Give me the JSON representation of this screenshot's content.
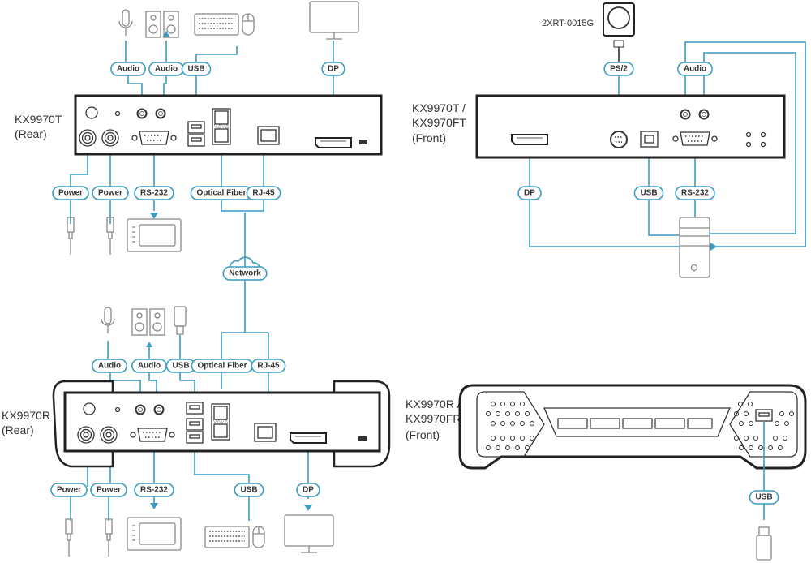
{
  "colors": {
    "connector_line": "#3a9cc0",
    "device_outline": "#222222",
    "peripheral": "#888888"
  },
  "top_left": {
    "title_line1": "KX9970T",
    "title_line2": "(Rear)",
    "labels": {
      "audio_in": "Audio",
      "audio_out": "Audio",
      "usb": "USB",
      "dp": "DP",
      "power1": "Power",
      "power2": "Power",
      "rs232": "RS-232",
      "optical": "Optical Fiber",
      "rj45": "RJ-45"
    }
  },
  "network": {
    "label": "Network"
  },
  "bottom_left": {
    "title_line1": "KX9970R",
    "title_line2": "(Rear)",
    "labels": {
      "audio_in": "Audio",
      "audio_out": "Audio",
      "usb_top": "USB",
      "optical": "Optical Fiber",
      "rj45": "RJ-45",
      "power1": "Power",
      "power2": "Power",
      "rs232": "RS-232",
      "usb_bottom": "USB",
      "dp": "DP"
    }
  },
  "top_right": {
    "title_line1": "KX9970T /",
    "title_line2": "KX9970FT",
    "title_line3": "(Front)",
    "controller_model": "2XRT-0015G",
    "labels": {
      "ps2": "PS/2",
      "audio": "Audio",
      "dp": "DP",
      "usb": "USB",
      "rs232": "RS-232"
    }
  },
  "bottom_right": {
    "title_line1": "KX9970R /",
    "title_line2": "KX9970FR",
    "title_line3": "(Front)",
    "labels": {
      "usb": "USB"
    }
  }
}
